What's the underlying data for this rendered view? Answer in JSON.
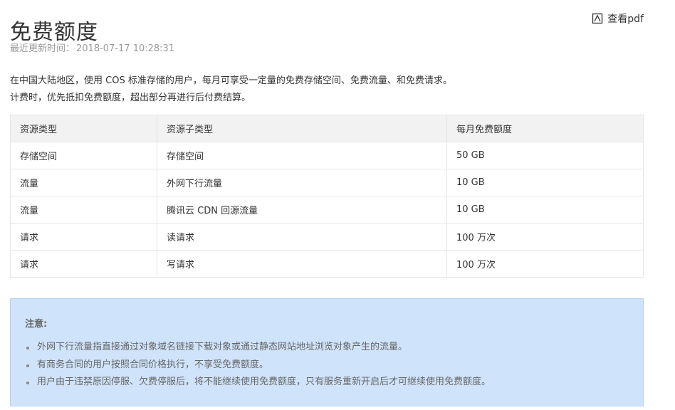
{
  "header": {
    "title": "免费额度",
    "pdf_label": "查看pdf",
    "pdf_icon": "pdf-view-icon"
  },
  "meta": {
    "updated_label": "最近更新时间：",
    "updated_value": "2018-07-17 10:28:31"
  },
  "intro": {
    "line1": "在中国大陆地区，使用 COS 标准存储的用户，每月可享受一定量的免费存储空间、免费流量、和免费请求。",
    "line2": "计费时，优先抵扣免费额度，超出部分再进行后付费结算。"
  },
  "table": {
    "headers": [
      "资源类型",
      "资源子类型",
      "每月免费额度"
    ],
    "rows": [
      [
        "存储空间",
        "存储空间",
        "50 GB"
      ],
      [
        "流量",
        "外网下行流量",
        "10 GB"
      ],
      [
        "流量",
        "腾讯云 CDN 回源流量",
        "10 GB"
      ],
      [
        "请求",
        "读请求",
        "100 万次"
      ],
      [
        "请求",
        "写请求",
        "100 万次"
      ]
    ]
  },
  "notice": {
    "title": "注意:",
    "items": [
      "外网下行流量指直接通过对象域名链接下载对象或通过静态网站地址浏览对象产生的流量。",
      "有商务合同的用户按照合同价格执行，不享受免费额度。",
      "用户由于违禁原因停服、欠费停服后，将不能继续使用免费额度，只有服务重新开启后才可继续使用免费额度。"
    ]
  },
  "colors": {
    "notice_bg": "#cfe3fb",
    "table_header_bg": "#f2f2f2",
    "border": "#e5e5e5"
  }
}
